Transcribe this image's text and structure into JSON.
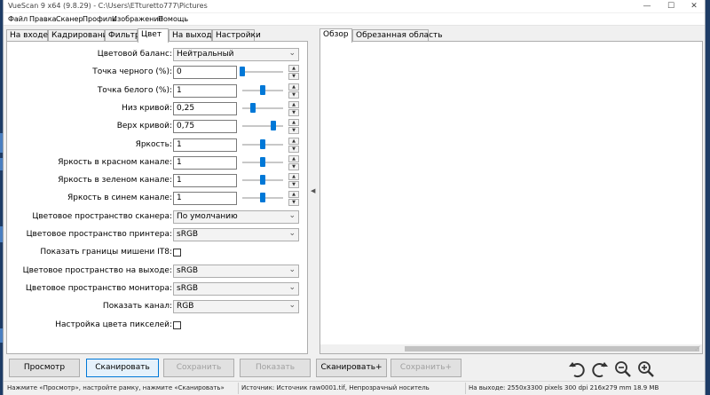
{
  "window": {
    "title": "VueScan 9 x64 (9.8.29) - C:\\Users\\ETturetto777\\Pictures",
    "controls": {
      "minimize": "—",
      "maximize": "☐",
      "close": "✕"
    }
  },
  "menu": [
    "Файл",
    "Правка",
    "Сканер",
    "Профиль",
    "Изображение",
    "Помощь"
  ],
  "left_tabs": [
    "На входе",
    "Кадрирование",
    "Фильтр",
    "Цвет",
    "На выходе",
    "Настройки"
  ],
  "active_left_tab": "Цвет",
  "rows": [
    {
      "label": "Цветовой баланс:",
      "type": "combo",
      "value": "Нейтральный"
    },
    {
      "label": "Точка черного (%):",
      "type": "slider",
      "value": "0",
      "level": 0.0
    },
    {
      "label": "Точка белого (%):",
      "type": "slider",
      "value": "1",
      "level": 0.5
    },
    {
      "label": "Низ кривой:",
      "type": "slider",
      "value": "0,25",
      "level": 0.25
    },
    {
      "label": "Верх кривой:",
      "type": "slider",
      "value": "0,75",
      "level": 0.75
    },
    {
      "label": "Яркость:",
      "type": "slider",
      "value": "1",
      "level": 0.5
    },
    {
      "label": "Яркость в красном канале:",
      "type": "slider",
      "value": "1",
      "level": 0.5
    },
    {
      "label": "Яркость в зеленом канале:",
      "type": "slider",
      "value": "1",
      "level": 0.5
    },
    {
      "label": "Яркость в синем канале:",
      "type": "slider",
      "value": "1",
      "level": 0.5
    },
    {
      "label": "Цветовое пространство сканера:",
      "type": "combo",
      "value": "По умолчанию"
    },
    {
      "label": "Цветовое пространство принтера:",
      "type": "combo",
      "value": "sRGB"
    },
    {
      "label": "Показать границы мишени IT8:",
      "type": "check",
      "value": ""
    },
    {
      "label": "Цветовое пространство на выходе:",
      "type": "combo",
      "value": "sRGB"
    },
    {
      "label": "Цветовое пространство монитора:",
      "type": "combo",
      "value": "sRGB"
    },
    {
      "label": "Показать канал:",
      "type": "combo",
      "value": "RGB"
    },
    {
      "label": "Настройка цвета пикселей:",
      "type": "check",
      "value": ""
    }
  ],
  "right_tabs": [
    "Обзор",
    "Обрезанная область"
  ],
  "active_right_tab": "Обзор",
  "collapse_arrow": "◀",
  "resize_grip": "⋰",
  "spin": {
    "up": "▲",
    "down": "▼"
  },
  "combo_chevron": "⌄",
  "buttons": [
    {
      "label": "Просмотр",
      "enabled": true,
      "primary": false
    },
    {
      "label": "Сканировать",
      "enabled": true,
      "primary": true
    },
    {
      "label": "Сохранить",
      "enabled": false,
      "primary": false
    },
    {
      "label": "Показать",
      "enabled": false,
      "primary": false
    },
    {
      "label": "Сканировать+",
      "enabled": true,
      "primary": false
    },
    {
      "label": "Сохранить+",
      "enabled": false,
      "primary": false
    }
  ],
  "tools": [
    "rotate-left-icon",
    "rotate-right-icon",
    "zoom-out-icon",
    "zoom-in-icon"
  ],
  "status": {
    "left": "Нажмите «Просмотр», настройте рамку, нажмите «Сканировать»",
    "middle": "Источник: Источник raw0001.tif, Непрозрачный носитель",
    "right": "На выходе: 2550x3300 pixels 300 dpi 216x279 mm 18.9 MB"
  },
  "colors": {
    "accent": "#0078d7",
    "desktop": "#1e3c66"
  }
}
